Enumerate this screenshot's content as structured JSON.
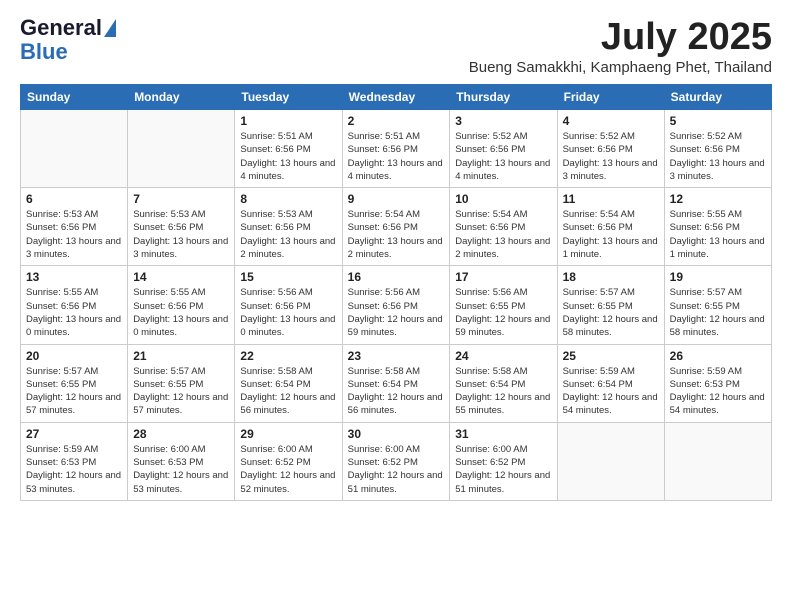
{
  "logo": {
    "general": "General",
    "blue": "Blue"
  },
  "title": {
    "month": "July 2025",
    "location": "Bueng Samakkhi, Kamphaeng Phet, Thailand"
  },
  "headers": [
    "Sunday",
    "Monday",
    "Tuesday",
    "Wednesday",
    "Thursday",
    "Friday",
    "Saturday"
  ],
  "weeks": [
    [
      {
        "day": "",
        "info": ""
      },
      {
        "day": "",
        "info": ""
      },
      {
        "day": "1",
        "info": "Sunrise: 5:51 AM\nSunset: 6:56 PM\nDaylight: 13 hours and 4 minutes."
      },
      {
        "day": "2",
        "info": "Sunrise: 5:51 AM\nSunset: 6:56 PM\nDaylight: 13 hours and 4 minutes."
      },
      {
        "day": "3",
        "info": "Sunrise: 5:52 AM\nSunset: 6:56 PM\nDaylight: 13 hours and 4 minutes."
      },
      {
        "day": "4",
        "info": "Sunrise: 5:52 AM\nSunset: 6:56 PM\nDaylight: 13 hours and 3 minutes."
      },
      {
        "day": "5",
        "info": "Sunrise: 5:52 AM\nSunset: 6:56 PM\nDaylight: 13 hours and 3 minutes."
      }
    ],
    [
      {
        "day": "6",
        "info": "Sunrise: 5:53 AM\nSunset: 6:56 PM\nDaylight: 13 hours and 3 minutes."
      },
      {
        "day": "7",
        "info": "Sunrise: 5:53 AM\nSunset: 6:56 PM\nDaylight: 13 hours and 3 minutes."
      },
      {
        "day": "8",
        "info": "Sunrise: 5:53 AM\nSunset: 6:56 PM\nDaylight: 13 hours and 2 minutes."
      },
      {
        "day": "9",
        "info": "Sunrise: 5:54 AM\nSunset: 6:56 PM\nDaylight: 13 hours and 2 minutes."
      },
      {
        "day": "10",
        "info": "Sunrise: 5:54 AM\nSunset: 6:56 PM\nDaylight: 13 hours and 2 minutes."
      },
      {
        "day": "11",
        "info": "Sunrise: 5:54 AM\nSunset: 6:56 PM\nDaylight: 13 hours and 1 minute."
      },
      {
        "day": "12",
        "info": "Sunrise: 5:55 AM\nSunset: 6:56 PM\nDaylight: 13 hours and 1 minute."
      }
    ],
    [
      {
        "day": "13",
        "info": "Sunrise: 5:55 AM\nSunset: 6:56 PM\nDaylight: 13 hours and 0 minutes."
      },
      {
        "day": "14",
        "info": "Sunrise: 5:55 AM\nSunset: 6:56 PM\nDaylight: 13 hours and 0 minutes."
      },
      {
        "day": "15",
        "info": "Sunrise: 5:56 AM\nSunset: 6:56 PM\nDaylight: 13 hours and 0 minutes."
      },
      {
        "day": "16",
        "info": "Sunrise: 5:56 AM\nSunset: 6:56 PM\nDaylight: 12 hours and 59 minutes."
      },
      {
        "day": "17",
        "info": "Sunrise: 5:56 AM\nSunset: 6:55 PM\nDaylight: 12 hours and 59 minutes."
      },
      {
        "day": "18",
        "info": "Sunrise: 5:57 AM\nSunset: 6:55 PM\nDaylight: 12 hours and 58 minutes."
      },
      {
        "day": "19",
        "info": "Sunrise: 5:57 AM\nSunset: 6:55 PM\nDaylight: 12 hours and 58 minutes."
      }
    ],
    [
      {
        "day": "20",
        "info": "Sunrise: 5:57 AM\nSunset: 6:55 PM\nDaylight: 12 hours and 57 minutes."
      },
      {
        "day": "21",
        "info": "Sunrise: 5:57 AM\nSunset: 6:55 PM\nDaylight: 12 hours and 57 minutes."
      },
      {
        "day": "22",
        "info": "Sunrise: 5:58 AM\nSunset: 6:54 PM\nDaylight: 12 hours and 56 minutes."
      },
      {
        "day": "23",
        "info": "Sunrise: 5:58 AM\nSunset: 6:54 PM\nDaylight: 12 hours and 56 minutes."
      },
      {
        "day": "24",
        "info": "Sunrise: 5:58 AM\nSunset: 6:54 PM\nDaylight: 12 hours and 55 minutes."
      },
      {
        "day": "25",
        "info": "Sunrise: 5:59 AM\nSunset: 6:54 PM\nDaylight: 12 hours and 54 minutes."
      },
      {
        "day": "26",
        "info": "Sunrise: 5:59 AM\nSunset: 6:53 PM\nDaylight: 12 hours and 54 minutes."
      }
    ],
    [
      {
        "day": "27",
        "info": "Sunrise: 5:59 AM\nSunset: 6:53 PM\nDaylight: 12 hours and 53 minutes."
      },
      {
        "day": "28",
        "info": "Sunrise: 6:00 AM\nSunset: 6:53 PM\nDaylight: 12 hours and 53 minutes."
      },
      {
        "day": "29",
        "info": "Sunrise: 6:00 AM\nSunset: 6:52 PM\nDaylight: 12 hours and 52 minutes."
      },
      {
        "day": "30",
        "info": "Sunrise: 6:00 AM\nSunset: 6:52 PM\nDaylight: 12 hours and 51 minutes."
      },
      {
        "day": "31",
        "info": "Sunrise: 6:00 AM\nSunset: 6:52 PM\nDaylight: 12 hours and 51 minutes."
      },
      {
        "day": "",
        "info": ""
      },
      {
        "day": "",
        "info": ""
      }
    ]
  ]
}
